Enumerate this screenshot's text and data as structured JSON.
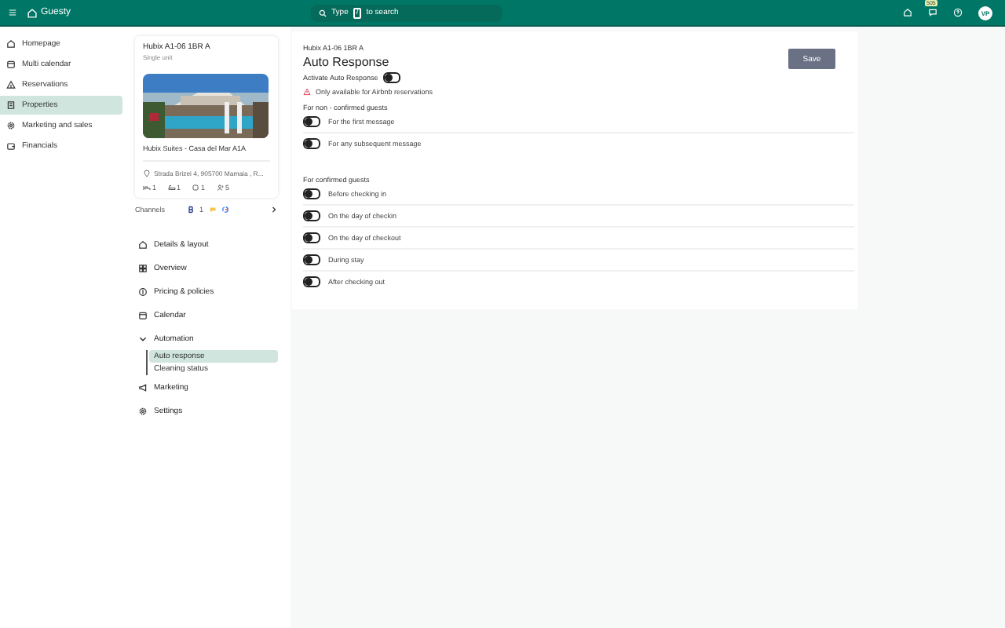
{
  "topbar": {
    "brand": "Guesty",
    "search": {
      "prefix": "Type",
      "key": "/",
      "suffix": "to search"
    },
    "badge": "505",
    "avatar": "VP"
  },
  "sidebar": {
    "items": [
      {
        "label": "Homepage",
        "kind": "home",
        "selected": false
      },
      {
        "label": "Multi calendar",
        "kind": "calendar",
        "selected": false
      },
      {
        "label": "Reservations",
        "kind": "tent",
        "selected": false
      },
      {
        "label": "Properties",
        "kind": "building",
        "selected": true
      },
      {
        "label": "Marketing and sales",
        "kind": "gear",
        "selected": false
      },
      {
        "label": "Financials",
        "kind": "wallet",
        "selected": false
      }
    ]
  },
  "property": {
    "name": "Hubix A1-06 1BR A",
    "unit_type": "Single unit",
    "listing_title": "Hubix Suites - Casa del Mar A1A",
    "address": "Strada Brizei 4, 905700 Mamaia , R...",
    "stats": [
      {
        "kind": "bed",
        "value": "1"
      },
      {
        "kind": "bath",
        "value": "1"
      },
      {
        "kind": "bedroom",
        "value": "1"
      },
      {
        "kind": "guests",
        "value": "5"
      }
    ],
    "channels_label": "Channels",
    "channel_count": "1",
    "nav": [
      {
        "label": "Details & layout",
        "kind": "home"
      },
      {
        "label": "Overview",
        "kind": "grid"
      },
      {
        "label": "Pricing & policies",
        "kind": "coin"
      },
      {
        "label": "Calendar",
        "kind": "calendar"
      },
      {
        "label": "Automation",
        "kind": "group",
        "children": [
          {
            "label": "Auto response",
            "selected": true
          },
          {
            "label": "Cleaning status",
            "selected": false
          }
        ]
      },
      {
        "label": "Marketing",
        "kind": "megaphone"
      },
      {
        "label": "Settings",
        "kind": "gear"
      }
    ]
  },
  "main": {
    "breadcrumb": "Hubix A1-06 1BR A",
    "title": "Auto Response",
    "activate": {
      "label": "Activate Auto Response",
      "on": false
    },
    "warning": "Only available for Airbnb reservations",
    "save": "Save",
    "sections": [
      {
        "title": "For non - confirmed guests",
        "rules": [
          {
            "label": "For the first message",
            "on": false
          },
          {
            "label": "For any subsequent message",
            "on": false
          }
        ]
      },
      {
        "title": "For confirmed guests",
        "rules": [
          {
            "label": "Before checking in",
            "on": false
          },
          {
            "label": "On the day of checkin",
            "on": false
          },
          {
            "label": "On the day of checkout",
            "on": false
          },
          {
            "label": "During stay",
            "on": false
          },
          {
            "label": "After checking out",
            "on": false
          }
        ]
      }
    ]
  }
}
